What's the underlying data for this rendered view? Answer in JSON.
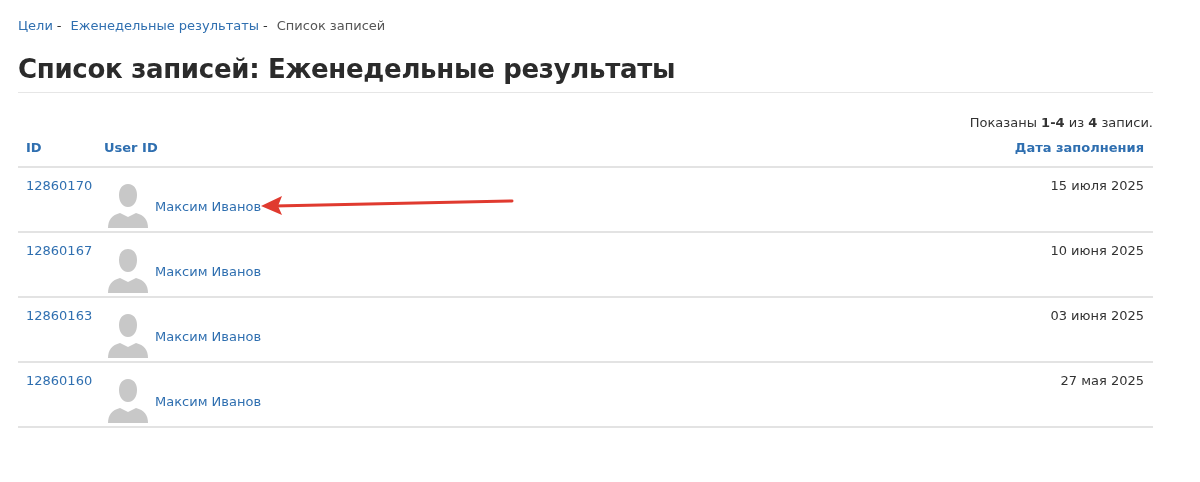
{
  "breadcrumb": {
    "separator": "-",
    "items": [
      {
        "label": "Цели",
        "link": true
      },
      {
        "label": "Еженедельные результаты",
        "link": true
      },
      {
        "label": "Список записей",
        "link": false
      }
    ]
  },
  "title": "Список записей: Еженедельные результаты",
  "summary": "Показаны **1-4** из **4** записи.",
  "table": {
    "columns": [
      "ID",
      "User ID",
      "Дата заполнения"
    ],
    "rows": [
      {
        "id": "12860170",
        "user": "Максим Иванов",
        "date": "15 июля 2025",
        "marked": true
      },
      {
        "id": "12860167",
        "user": "Максим Иванов",
        "date": "10 июня 2025",
        "marked": false
      },
      {
        "id": "12860163",
        "user": "Максим Иванов",
        "date": "03 июня 2025",
        "marked": false
      },
      {
        "id": "12860160",
        "user": "Максим Иванов",
        "date": "27 мая 2025",
        "marked": false
      }
    ]
  }
}
